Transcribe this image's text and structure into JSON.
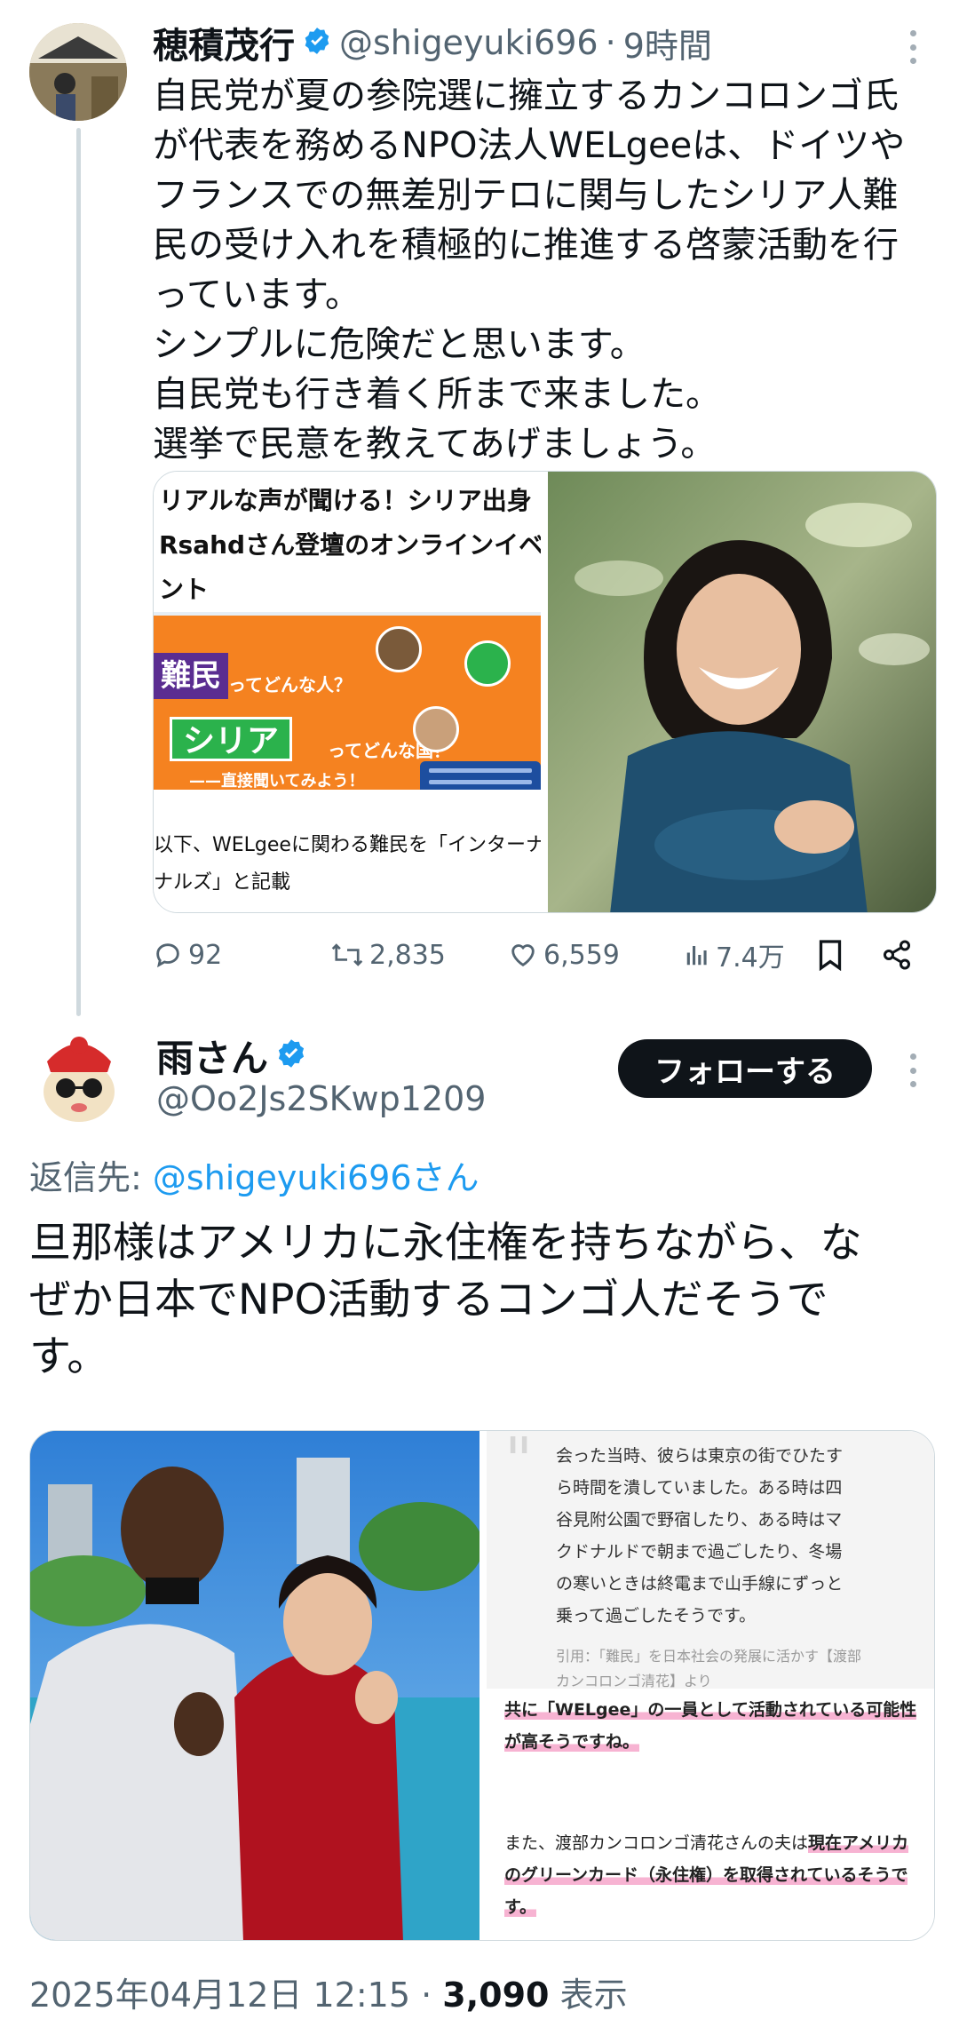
{
  "tweet1": {
    "display_name": "穂積茂行",
    "handle": "@shigeyuki696",
    "separator": "·",
    "time_ago": "9時間",
    "text_lines": [
      "自民党が夏の参院選に擁立するカンコロンゴ氏",
      "が代表を務めるNPO法人WELgeeは、ドイツや",
      "フランスでの無差別テロに関与したシリア人難",
      "民の受け入れを積極的に推進する啓蒙活動を行",
      "っています。",
      "シンプルに危険だと思います。",
      "自民党も行き着く所まで来ました。",
      "選挙で民意を教えてあげましょう。"
    ],
    "media_card": {
      "title_lines": [
        "リアルな声が聞ける！シリア出身",
        "Rsahdさん登壇のオンラインイベ",
        "ント"
      ],
      "banner_tag1": "難民",
      "banner_text1": "ってどんな人？",
      "banner_tag2": "シリア",
      "banner_text2": "ってどんな国？",
      "banner_text3": "——直接聞いてみよう！",
      "caption_lines": [
        "以下、WELgeeに関わる難民を「インターナシ",
        "ナルズ」と記載"
      ]
    },
    "actions": {
      "replies": "92",
      "retweets": "2,835",
      "likes": "6,559",
      "views": "7.4万"
    }
  },
  "tweet2": {
    "display_name": "雨さん",
    "handle": "@Oo2Js2SKwp1209",
    "follow_label": "フォローする",
    "reply_prefix": "返信先: ",
    "reply_handle": "@shigeyuki696さん",
    "text_lines": [
      "旦那様はアメリカに永住権を持ちながら、な",
      "ぜか日本でNPO活動するコンゴ人だそうで",
      "す。"
    ],
    "quote_lines": [
      "会った当時、彼らは東京の街でひたす",
      "ら時間を潰していました。ある時は四",
      "谷見附公園で野宿したり、ある時はマ",
      "クドナルドで朝まで過ごしたり、冬場",
      "の寒いときは終電まで山手線にずっと",
      "乗って過ごしたそうです。"
    ],
    "quote_source_lines": [
      "引用：「難民」を日本社会の発展に活かす【渡部",
      "カンコロンゴ清花】より"
    ],
    "article_line1": "共に「WELgee」の一員として活動されている可能性",
    "article_line2": "が高そうですね。",
    "article_line3_plain": "また、渡部カンコロンゴ清花さんの夫は",
    "article_line3_bold": "現在アメリカ",
    "article_line4": "のグリーンカード（永住権）を取得されているそうで",
    "article_line5": "す。",
    "timestamp": "2025年04月12日 12:15",
    "separator": "·",
    "view_count": "3,090",
    "view_label": "表示"
  },
  "colors": {
    "accent": "#1d9bf0",
    "text": "#0f1419",
    "secondary": "#536471",
    "banner_orange": "#f58220",
    "banner_purple": "#5a2d91",
    "banner_green": "#2bb24c"
  }
}
